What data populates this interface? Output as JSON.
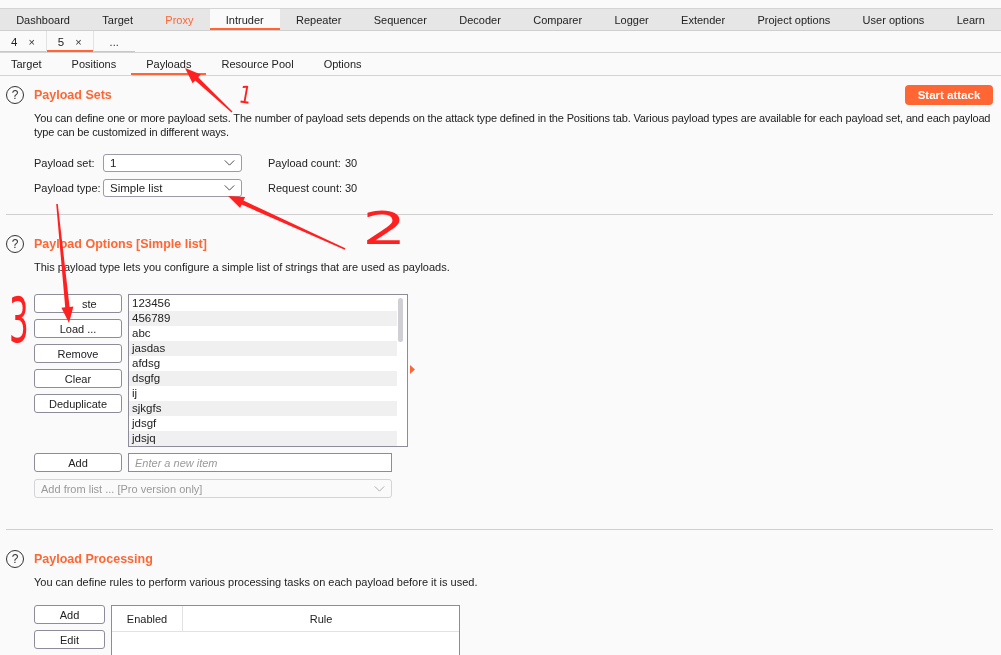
{
  "main_tabs": [
    {
      "label": "Dashboard",
      "selected": false,
      "highlighted": false
    },
    {
      "label": "Target",
      "selected": false,
      "highlighted": false
    },
    {
      "label": "Proxy",
      "selected": false,
      "highlighted": true
    },
    {
      "label": "Intruder",
      "selected": true,
      "highlighted": false
    },
    {
      "label": "Repeater",
      "selected": false,
      "highlighted": false
    },
    {
      "label": "Sequencer",
      "selected": false,
      "highlighted": false
    },
    {
      "label": "Decoder",
      "selected": false,
      "highlighted": false
    },
    {
      "label": "Comparer",
      "selected": false,
      "highlighted": false
    },
    {
      "label": "Logger",
      "selected": false,
      "highlighted": false
    },
    {
      "label": "Extender",
      "selected": false,
      "highlighted": false
    },
    {
      "label": "Project options",
      "selected": false,
      "highlighted": false
    },
    {
      "label": "User options",
      "selected": false,
      "highlighted": false
    },
    {
      "label": "Learn",
      "selected": false,
      "highlighted": false
    }
  ],
  "instance_tabs": [
    {
      "label": "4",
      "close": "×",
      "selected": false
    },
    {
      "label": "5",
      "close": "×",
      "selected": true
    }
  ],
  "instance_more": "...",
  "intruder_tabs": [
    {
      "label": "Target",
      "selected": false
    },
    {
      "label": "Positions",
      "selected": false
    },
    {
      "label": "Payloads",
      "selected": true
    },
    {
      "label": "Resource Pool",
      "selected": false
    },
    {
      "label": "Options",
      "selected": false
    }
  ],
  "payload_sets": {
    "help": "?",
    "title": "Payload Sets",
    "start_button": "Start attack",
    "description": "You can define one or more payload sets. The number of payload sets depends on the attack type defined in the Positions tab. Various payload types are available for each payload set, and each payload type can be customized in different ways.",
    "fields": [
      {
        "label": "Payload set:",
        "value": "1",
        "count_label": "Payload count:",
        "count": "30"
      },
      {
        "label": "Payload type:",
        "value": "Simple list",
        "count_label": "Request count:",
        "count": "30"
      }
    ]
  },
  "payload_options": {
    "help": "?",
    "title": "Payload Options [Simple list]",
    "description": "This payload type lets you configure a simple list of strings that are used as payloads.",
    "buttons": [
      "ste",
      "Load ...",
      "Remove",
      "Clear",
      "Deduplicate"
    ],
    "items": [
      "123456",
      "456789",
      "abc",
      "jasdas",
      "afdsg",
      "dsgfg",
      "ij",
      "sjkgfs",
      "jdsgf",
      "jdsjq"
    ],
    "add_button": "Add",
    "new_item": {
      "placeholder": "Enter a new item"
    },
    "add_from_list": {
      "value": "Add from list ... [Pro version only]",
      "disabled": true
    }
  },
  "payload_processing": {
    "help": "?",
    "title": "Payload Processing",
    "description": "You can define rules to perform various processing tasks on each payload before it is used.",
    "buttons": [
      "Add",
      "Edit"
    ],
    "table": {
      "columns": [
        "Enabled",
        "Rule"
      ]
    }
  },
  "annotations": [
    {
      "label": "1"
    },
    {
      "label": "2"
    },
    {
      "label": "3"
    }
  ]
}
